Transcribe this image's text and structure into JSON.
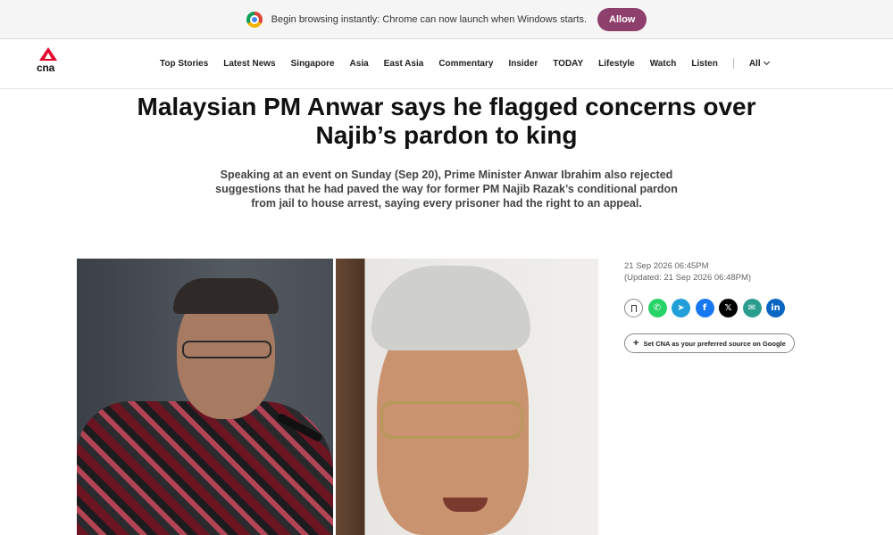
{
  "infobar": {
    "message": "Begin browsing instantly: Chrome can now launch when Windows starts.",
    "allow_label": "Allow"
  },
  "header": {
    "logo_text": "cna",
    "nav": [
      "Top Stories",
      "Latest News",
      "Singapore",
      "Asia",
      "East Asia",
      "Commentary",
      "Insider",
      "TODAY",
      "Lifestyle",
      "Watch",
      "Listen"
    ],
    "all_label": "All"
  },
  "article": {
    "headline_line1": "Malaysian PM Anwar says he flagged concerns over",
    "headline_line2": "Najib’s pardon to king",
    "standfirst_line1": "Speaking at an event on Sunday (Sep 20), Prime Minister Anwar Ibrahim also rejected",
    "standfirst_line2": "suggestions that he had paved the way for former PM Najib Razak’s conditional pardon",
    "standfirst_line3": "from jail to house arrest, saying every prisoner had the right to an appeal.",
    "published": "21 Sep 2026 06:45PM",
    "updated": "(Updated: 21 Sep 2026 06:48PM)",
    "preferred_source_label": "Set CNA as your preferred source on Google"
  },
  "share": {
    "icons": [
      "bookmark-icon",
      "whatsapp-icon",
      "telegram-icon",
      "facebook-icon",
      "x-icon",
      "email-icon",
      "linkedin-icon"
    ],
    "glyphs": {
      "whatsapp": "✆",
      "telegram": "➤",
      "facebook": "f",
      "x": "𝕏",
      "email": "✉",
      "linkedin": "in"
    }
  },
  "colors": {
    "allow_button": "#8e3f6c",
    "brand_red": "#e4002b"
  }
}
